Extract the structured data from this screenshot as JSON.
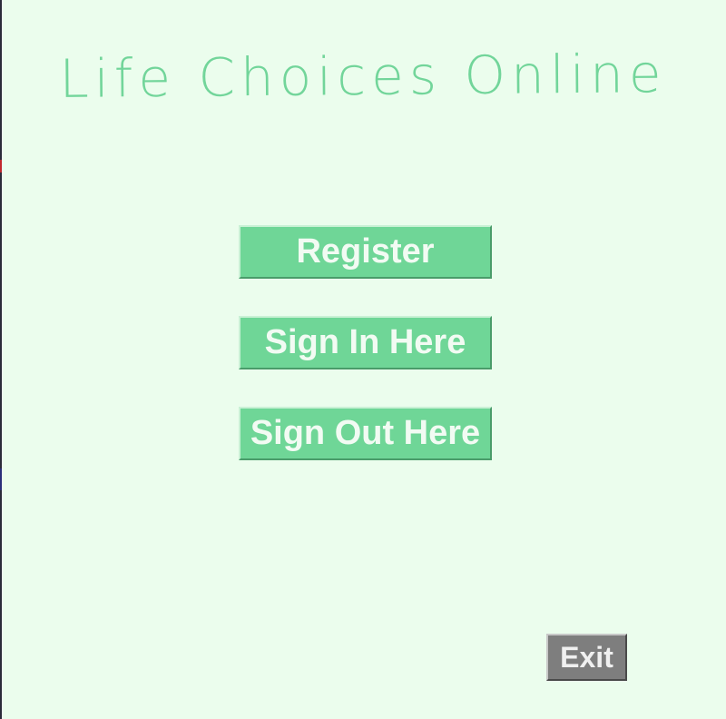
{
  "app": {
    "title": "Life Choices Online"
  },
  "buttons": {
    "register": "Register",
    "sign_in": "Sign In Here",
    "sign_out": "Sign Out Here",
    "exit": "Exit"
  },
  "colors": {
    "background": "#ebfded",
    "accent": "#6fd697",
    "title": "#72d59a",
    "exit": "#7e7e7e"
  }
}
